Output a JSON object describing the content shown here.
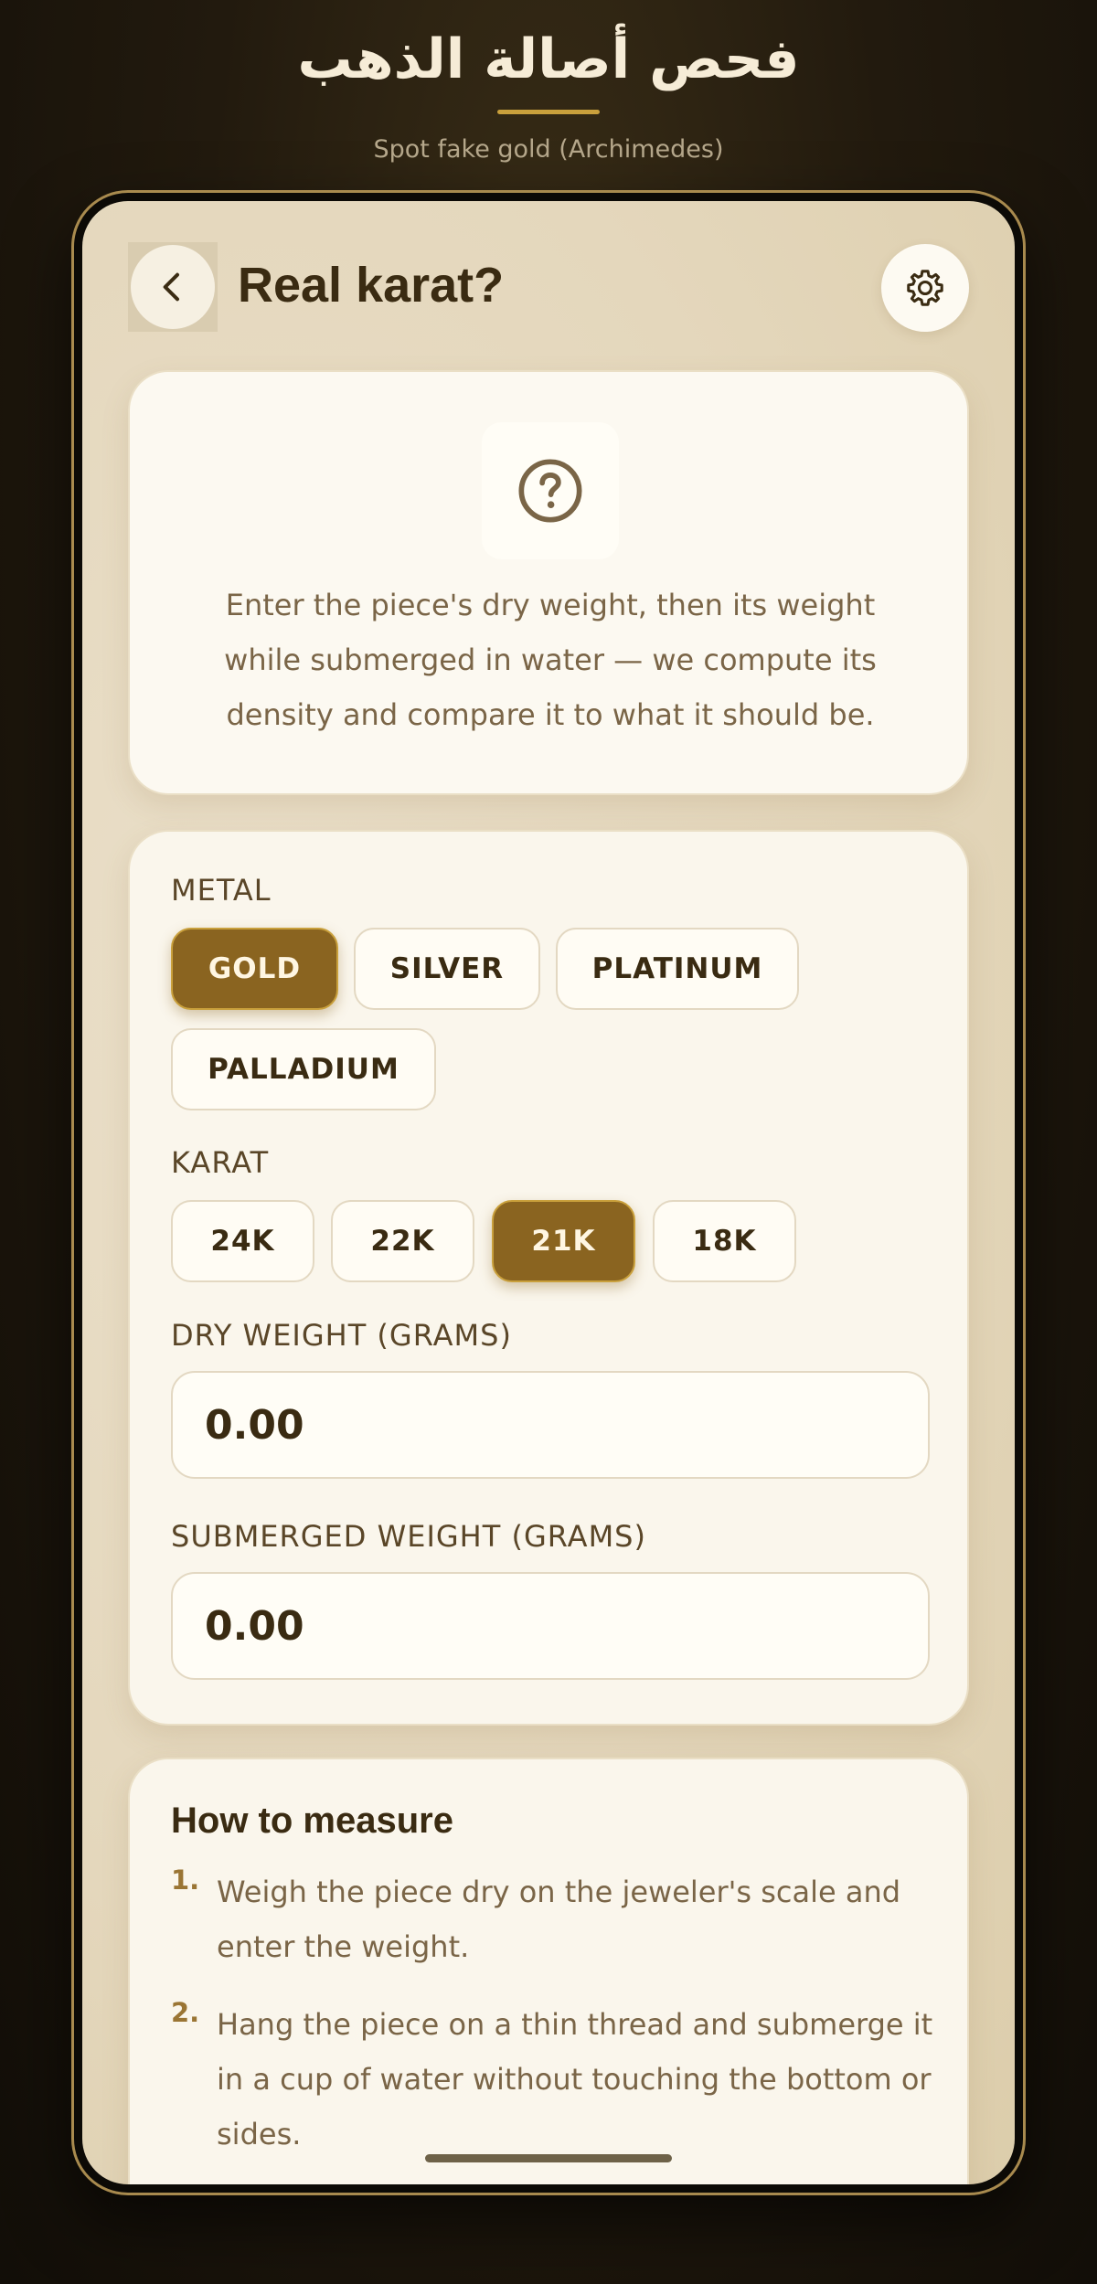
{
  "header": {
    "title": "فحص أصالة الذهب",
    "subtitle": "Spot fake gold (Archimedes)"
  },
  "topbar": {
    "back_icon": "chevron-left-icon",
    "title": "Real karat?",
    "settings_icon": "gear-icon"
  },
  "intro": {
    "icon": "question-circle-icon",
    "text": "Enter the piece's dry weight, then its weight while submerged in water — we compute its density and compare it to what it should be."
  },
  "form": {
    "metal_label": "METAL",
    "metals": [
      {
        "label": "GOLD",
        "selected": true
      },
      {
        "label": "SILVER",
        "selected": false
      },
      {
        "label": "PLATINUM",
        "selected": false
      },
      {
        "label": "PALLADIUM",
        "selected": false
      }
    ],
    "karat_label": "KARAT",
    "karats": [
      {
        "label": "24K",
        "selected": false
      },
      {
        "label": "22K",
        "selected": false
      },
      {
        "label": "21K",
        "selected": true
      },
      {
        "label": "18K",
        "selected": false
      }
    ],
    "dry_weight_label": "DRY WEIGHT (GRAMS)",
    "dry_weight_placeholder": "0.00",
    "submerged_weight_label": "SUBMERGED WEIGHT (GRAMS)",
    "submerged_weight_placeholder": "0.00"
  },
  "howto": {
    "title": "How to measure",
    "steps": [
      {
        "num": "1.",
        "text": "Weigh the piece dry on the jeweler's scale and enter the weight."
      },
      {
        "num": "2.",
        "text": "Hang the piece on a thin thread and submerge it in a cup of water without touching the bottom or sides."
      }
    ]
  },
  "colors": {
    "accent": "#8a6420",
    "gold_line": "#c9a03c",
    "text_dark": "#3a2b12"
  }
}
